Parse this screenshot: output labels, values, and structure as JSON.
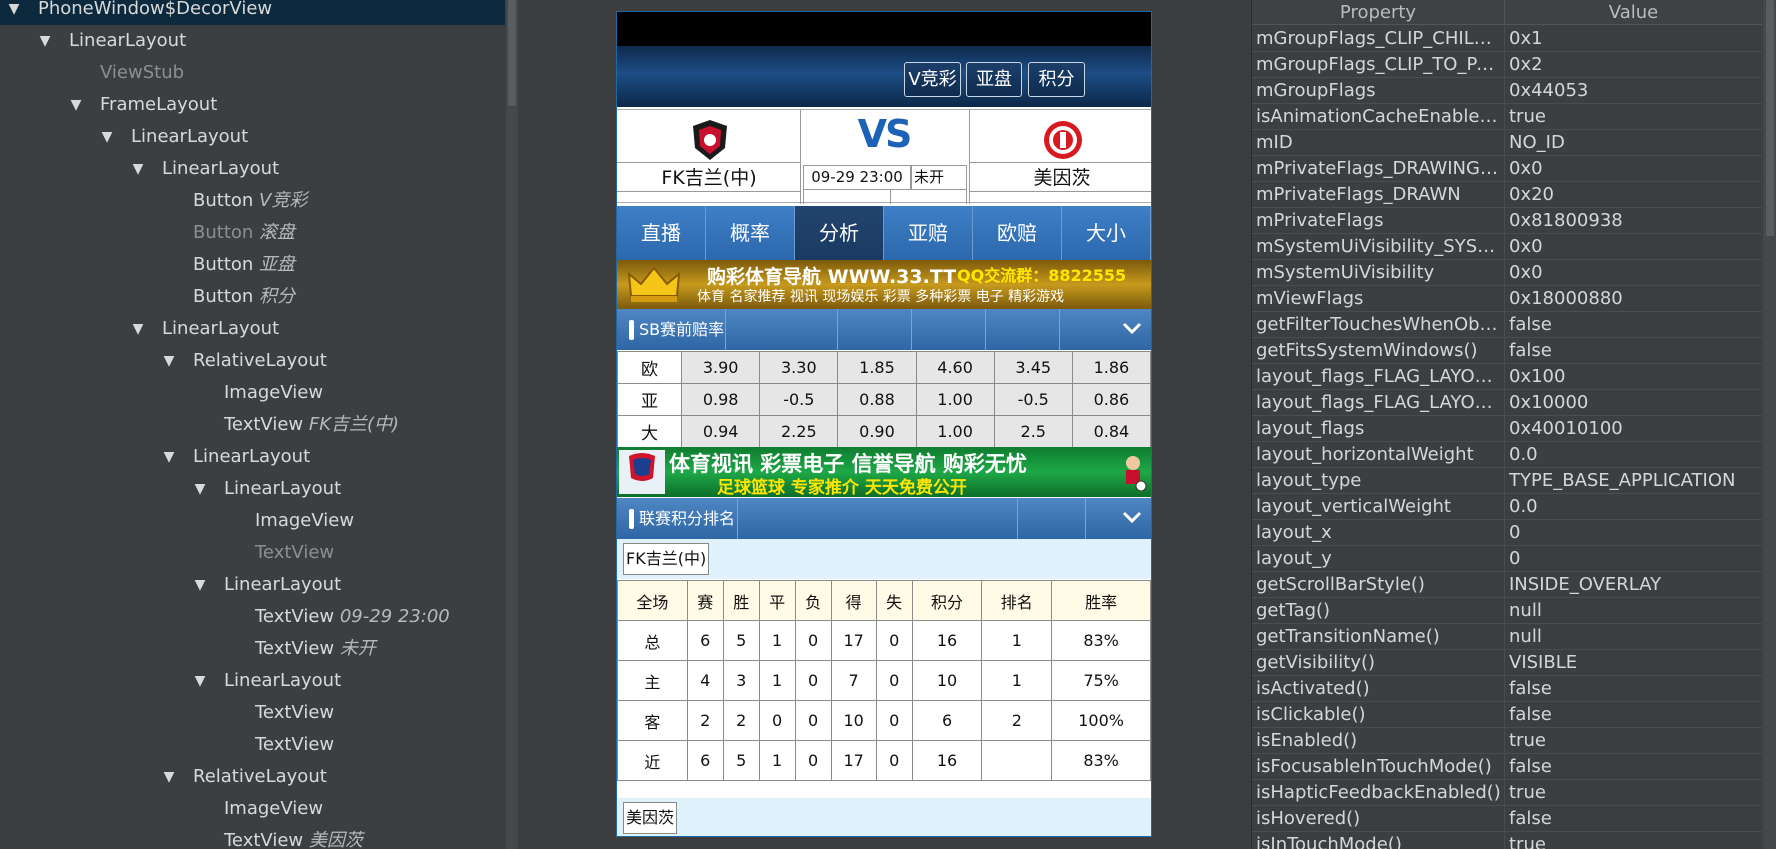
{
  "tree": {
    "nodes": [
      {
        "label": "PhoneWindow$DecorView",
        "extra": "",
        "toggle": "▼",
        "dim": false,
        "selected": true
      },
      {
        "label": "LinearLayout",
        "extra": "",
        "toggle": "▼",
        "dim": false,
        "selected": false
      },
      {
        "label": "ViewStub",
        "extra": "",
        "toggle": "",
        "dim": true,
        "selected": false
      },
      {
        "label": "FrameLayout",
        "extra": "",
        "toggle": "▼",
        "dim": false,
        "selected": false
      },
      {
        "label": "LinearLayout",
        "extra": "",
        "toggle": "▼",
        "dim": false,
        "selected": false
      },
      {
        "label": "LinearLayout",
        "extra": "",
        "toggle": "▼",
        "dim": false,
        "selected": false
      },
      {
        "label": "Button",
        "extra": "V竞彩",
        "toggle": "",
        "dim": false,
        "selected": false
      },
      {
        "label": "Button",
        "extra": "滚盘",
        "toggle": "",
        "dim": true,
        "selected": false
      },
      {
        "label": "Button",
        "extra": "亚盘",
        "toggle": "",
        "dim": false,
        "selected": false
      },
      {
        "label": "Button",
        "extra": "积分",
        "toggle": "",
        "dim": false,
        "selected": false
      },
      {
        "label": "LinearLayout",
        "extra": "",
        "toggle": "▼",
        "dim": false,
        "selected": false
      },
      {
        "label": "RelativeLayout",
        "extra": "",
        "toggle": "▼",
        "dim": false,
        "selected": false
      },
      {
        "label": "ImageView",
        "extra": "",
        "toggle": "",
        "dim": false,
        "selected": false
      },
      {
        "label": "TextView",
        "extra": "FK吉兰(中)",
        "toggle": "",
        "dim": false,
        "selected": false
      },
      {
        "label": "LinearLayout",
        "extra": "",
        "toggle": "▼",
        "dim": false,
        "selected": false
      },
      {
        "label": "LinearLayout",
        "extra": "",
        "toggle": "▼",
        "dim": false,
        "selected": false
      },
      {
        "label": "ImageView",
        "extra": "",
        "toggle": "",
        "dim": false,
        "selected": false
      },
      {
        "label": "TextView",
        "extra": "",
        "toggle": "",
        "dim": true,
        "selected": false
      },
      {
        "label": "LinearLayout",
        "extra": "",
        "toggle": "▼",
        "dim": false,
        "selected": false
      },
      {
        "label": "TextView",
        "extra": "09-29 23:00",
        "toggle": "",
        "dim": false,
        "selected": false
      },
      {
        "label": "TextView",
        "extra": "未开",
        "toggle": "",
        "dim": false,
        "selected": false
      },
      {
        "label": "LinearLayout",
        "extra": "",
        "toggle": "▼",
        "dim": false,
        "selected": false
      },
      {
        "label": "TextView",
        "extra": "",
        "toggle": "",
        "dim": false,
        "selected": false
      },
      {
        "label": "TextView",
        "extra": "",
        "toggle": "",
        "dim": false,
        "selected": false
      },
      {
        "label": "RelativeLayout",
        "extra": "",
        "toggle": "▼",
        "dim": false,
        "selected": false
      },
      {
        "label": "ImageView",
        "extra": "",
        "toggle": "",
        "dim": false,
        "selected": false
      },
      {
        "label": "TextView",
        "extra": "美因茨",
        "toggle": "",
        "dim": false,
        "selected": false
      }
    ]
  },
  "props": {
    "header": {
      "property": "Property",
      "value": "Value"
    },
    "rows": [
      {
        "k": "mGroupFlags_CLIP_CHILD...",
        "v": "0x1"
      },
      {
        "k": "mGroupFlags_CLIP_TO_PA...",
        "v": "0x2"
      },
      {
        "k": "mGroupFlags",
        "v": "0x44053"
      },
      {
        "k": "isAnimationCacheEnabled()",
        "v": "true"
      },
      {
        "k": "mID",
        "v": "NO_ID"
      },
      {
        "k": "mPrivateFlags_DRAWING_...",
        "v": "0x0"
      },
      {
        "k": "mPrivateFlags_DRAWN",
        "v": "0x20"
      },
      {
        "k": "mPrivateFlags",
        "v": "0x81800938"
      },
      {
        "k": "mSystemUiVisibility_SYSTE...",
        "v": "0x0"
      },
      {
        "k": "mSystemUiVisibility",
        "v": "0x0"
      },
      {
        "k": "mViewFlags",
        "v": "0x18000880"
      },
      {
        "k": "getFilterTouchesWhenObs...",
        "v": "false"
      },
      {
        "k": "getFitsSystemWindows()",
        "v": "false"
      },
      {
        "k": "layout_flags_FLAG_LAYOU...",
        "v": "0x100"
      },
      {
        "k": "layout_flags_FLAG_LAYOU...",
        "v": "0x10000"
      },
      {
        "k": "layout_flags",
        "v": "0x40010100"
      },
      {
        "k": "layout_horizontalWeight",
        "v": "0.0"
      },
      {
        "k": "layout_type",
        "v": "TYPE_BASE_APPLICATION"
      },
      {
        "k": "layout_verticalWeight",
        "v": "0.0"
      },
      {
        "k": "layout_x",
        "v": "0"
      },
      {
        "k": "layout_y",
        "v": "0"
      },
      {
        "k": "getScrollBarStyle()",
        "v": "INSIDE_OVERLAY"
      },
      {
        "k": "getTag()",
        "v": "null"
      },
      {
        "k": "getTransitionName()",
        "v": "null"
      },
      {
        "k": "getVisibility()",
        "v": "VISIBLE"
      },
      {
        "k": "isActivated()",
        "v": "false"
      },
      {
        "k": "isClickable()",
        "v": "false"
      },
      {
        "k": "isEnabled()",
        "v": "true"
      },
      {
        "k": "isFocusableInTouchMode()",
        "v": "false"
      },
      {
        "k": "isHapticFeedbackEnabled()",
        "v": "true"
      },
      {
        "k": "isHovered()",
        "v": "false"
      },
      {
        "k": "isInTouchMode()",
        "v": "true"
      }
    ]
  },
  "phone": {
    "top_buttons": [
      "V竞彩",
      "亚盘",
      "积分"
    ],
    "home_team": "FK吉兰(中)",
    "away_team": "美因茨",
    "vs": "VS",
    "match_time": "09-29 23:00",
    "match_status": "未开",
    "tabs": [
      "直播",
      "概率",
      "分析",
      "亚赔",
      "欧赔",
      "大小"
    ],
    "active_tab": 2,
    "banner1": {
      "main": "购彩体育导航 WWW.33.TT",
      "qq": "QQ交流群：8822555",
      "sub": "体育 名家推荐  视讯 现场娱乐  彩票 多种彩票  电子 精彩游戏"
    },
    "banner2": {
      "line1": "体育视讯 彩票电子 信誉导航 购彩无忧",
      "line2": "足球篮球 专家推介 天天免费公开"
    },
    "section1_title": "SB赛前赔率",
    "odds": [
      {
        "label": "欧",
        "values": [
          "3.90",
          "3.30",
          "1.85",
          "4.60",
          "3.45",
          "1.86"
        ]
      },
      {
        "label": "亚",
        "values": [
          "0.98",
          "-0.5",
          "0.88",
          "1.00",
          "-0.5",
          "0.86"
        ]
      },
      {
        "label": "大",
        "values": [
          "0.94",
          "2.25",
          "0.90",
          "1.00",
          "2.5",
          "0.84"
        ]
      }
    ],
    "section2_title": "联赛积分排名",
    "standing_team_home": "FK吉兰(中)",
    "standing_team_away": "美因茨",
    "standing_headers": [
      "全场",
      "赛",
      "胜",
      "平",
      "负",
      "得",
      "失",
      "积分",
      "排名",
      "胜率"
    ],
    "standing_rows": [
      [
        "总",
        "6",
        "5",
        "1",
        "0",
        "17",
        "0",
        "16",
        "1",
        "83%"
      ],
      [
        "主",
        "4",
        "3",
        "1",
        "0",
        "7",
        "0",
        "10",
        "1",
        "75%"
      ],
      [
        "客",
        "2",
        "2",
        "0",
        "0",
        "10",
        "0",
        "6",
        "2",
        "100%"
      ],
      [
        "近",
        "6",
        "5",
        "1",
        "0",
        "17",
        "0",
        "16",
        "",
        "83%"
      ]
    ]
  }
}
